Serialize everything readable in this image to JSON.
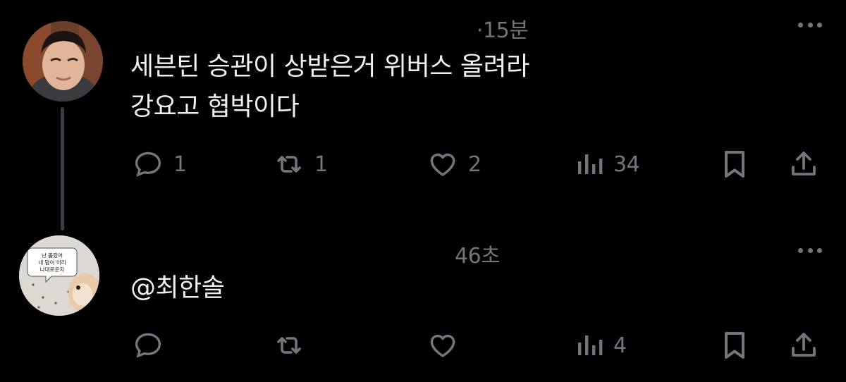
{
  "tweets": [
    {
      "timestamp": "·15분",
      "text": "세븐틴 승관이 상받은거 위버스 올려라\n강요고 협박이다",
      "replies": "1",
      "retweets": "1",
      "likes": "2",
      "views": "34"
    },
    {
      "timestamp": "46초",
      "text": "@최한솔",
      "replies": "",
      "retweets": "",
      "likes": "",
      "views": "4",
      "avatar_bubble": "난 몰랐어\n내 맘이 이리\n나대로운지"
    }
  ],
  "colors": {
    "background": "#000000",
    "text": "#e7e9ea",
    "muted": "#71767b",
    "thread_line": "#3a3d41"
  }
}
